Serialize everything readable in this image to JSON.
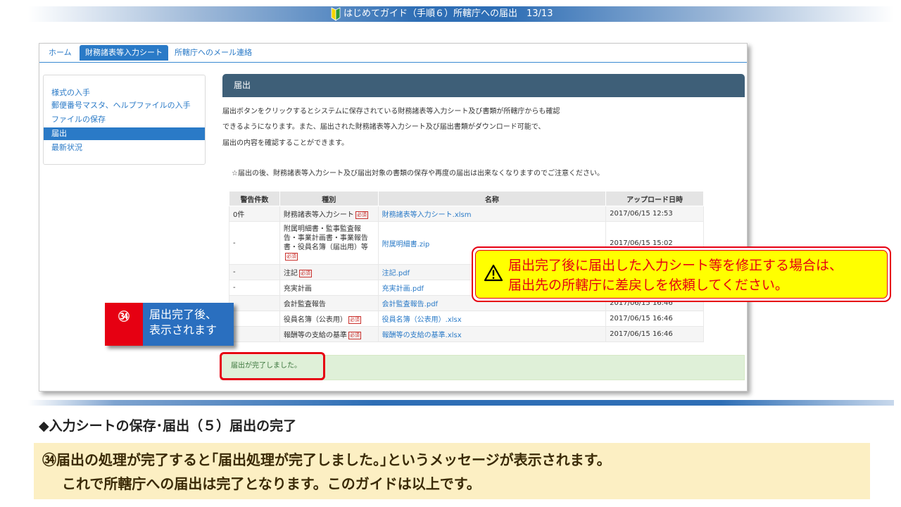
{
  "header": {
    "title": "はじめてガイド（手順６）所轄庁への届出　13/13",
    "beginner_mark_colors": [
      "#f5d400",
      "#2e9a3a"
    ]
  },
  "app": {
    "tabs": [
      {
        "label": "ホーム",
        "active": false
      },
      {
        "label": "財務諸表等入力シート",
        "active": true
      },
      {
        "label": "所轄庁へのメール連絡",
        "active": false
      }
    ],
    "sidebar": [
      {
        "label": "様式の入手",
        "active": false
      },
      {
        "label": "郵便番号マスタ、ヘルプファイルの入手",
        "active": false
      },
      {
        "label": "ファイルの保存",
        "active": false
      },
      {
        "label": "届出",
        "active": true
      },
      {
        "label": "最新状況",
        "active": false
      }
    ],
    "panel_title": "届出",
    "description": [
      "届出ボタンをクリックするとシステムに保存されている財務諸表等入力シート及び書類が所轄庁からも確認",
      "できるようになります。また、届出された財務諸表等入力シート及び届出書類がダウンロード可能で、",
      "届出の内容を確認することができます。"
    ],
    "notice": "☆届出の後、財務諸表等入力シート及び届出対象の書類の保存や再度の届出は出来なくなりますのでご注意ください。",
    "table": {
      "headers": [
        "警告件数",
        "種別",
        "名称",
        "アップロード日時"
      ],
      "required_badge": "必須",
      "rows": [
        {
          "count": "0件",
          "type": "財務諸表等入力シート",
          "required": true,
          "name": "財務諸表等入力シート.xlsm",
          "datetime": "2017/06/15 12:53"
        },
        {
          "count": "-",
          "type": "附属明細書・監事監査報告・事業計画書・事業報告書・役員名簿（届出用）等",
          "required": true,
          "name": "附属明細書.zip",
          "datetime": "2017/06/15 15:02"
        },
        {
          "count": "-",
          "type": "注記",
          "required": true,
          "name": "注記.pdf",
          "datetime": ""
        },
        {
          "count": "-",
          "type": "充実計画",
          "required": false,
          "name": "充実計画.pdf",
          "datetime": ""
        },
        {
          "count": "",
          "type": "会計監査報告",
          "required": false,
          "name": "会計監査報告.pdf",
          "datetime": "2017/06/15 16:46"
        },
        {
          "count": "",
          "type": "役員名簿（公表用）",
          "required": true,
          "name": "役員名簿（公表用）.xlsx",
          "datetime": "2017/06/15 16:46"
        },
        {
          "count": "",
          "type": "報酬等の支給の基準",
          "required": true,
          "name": "報酬等の支給の基準.xlsx",
          "datetime": "2017/06/15 16:46"
        }
      ]
    },
    "success_message": "届出が完了しました。"
  },
  "callout": {
    "number": "㉞",
    "text_line1": "届出完了後、",
    "text_line2": "表示されます"
  },
  "warning": {
    "line1": "届出完了後に届出した入力シート等を修正する場合は、",
    "line2": "届出先の所轄庁に差戻しを依頼してください。"
  },
  "section_title": "◆入力シートの保存･届出（５）届出の完了",
  "summary": {
    "line1": "㉞届出の処理が完了すると｢届出処理が完了しました。｣というメッセージが表示されます。",
    "line2": "これで所轄庁への届出は完了となります。このガイドは以上です。"
  },
  "colors": {
    "accent_blue": "#2a7ac7",
    "panel_header": "#3e5f78",
    "alert_red": "#e60012",
    "warning_yellow": "#ffff00",
    "summary_bg": "#fcefc3",
    "success_bg": "#dff0d8"
  }
}
